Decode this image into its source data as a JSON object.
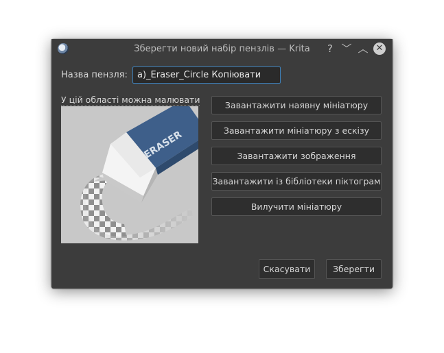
{
  "window": {
    "title": "Зберегти новий набір пензлів — Krita",
    "app_icon": "krita-logo-icon",
    "controls": {
      "help": "?",
      "minimize": "﹀",
      "maximize": "︿",
      "close": "✕"
    }
  },
  "form": {
    "name_label": "Назва пензля:",
    "name_value": "a)_Eraser_Circle Копіювати"
  },
  "canvas": {
    "label": "У цій області можна малювати",
    "eraser_text": "ERASER"
  },
  "actions": {
    "load_existing": "Завантажити наявну мініатюру",
    "load_scratch": "Завантажити мініатюру з ескізу",
    "load_image": "Завантажити зображення",
    "load_icon_library": "Завантажити із бібліотеки піктограм",
    "clear_thumbnail": "Вилучити мініатюру"
  },
  "footer": {
    "cancel": "Скасувати",
    "save": "Зберегти"
  },
  "colors": {
    "window_bg": "#3c3c3c",
    "button_bg": "#2e2e2e",
    "input_focus": "#3d7fb8",
    "eraser_blue": "#3e5f8a"
  }
}
